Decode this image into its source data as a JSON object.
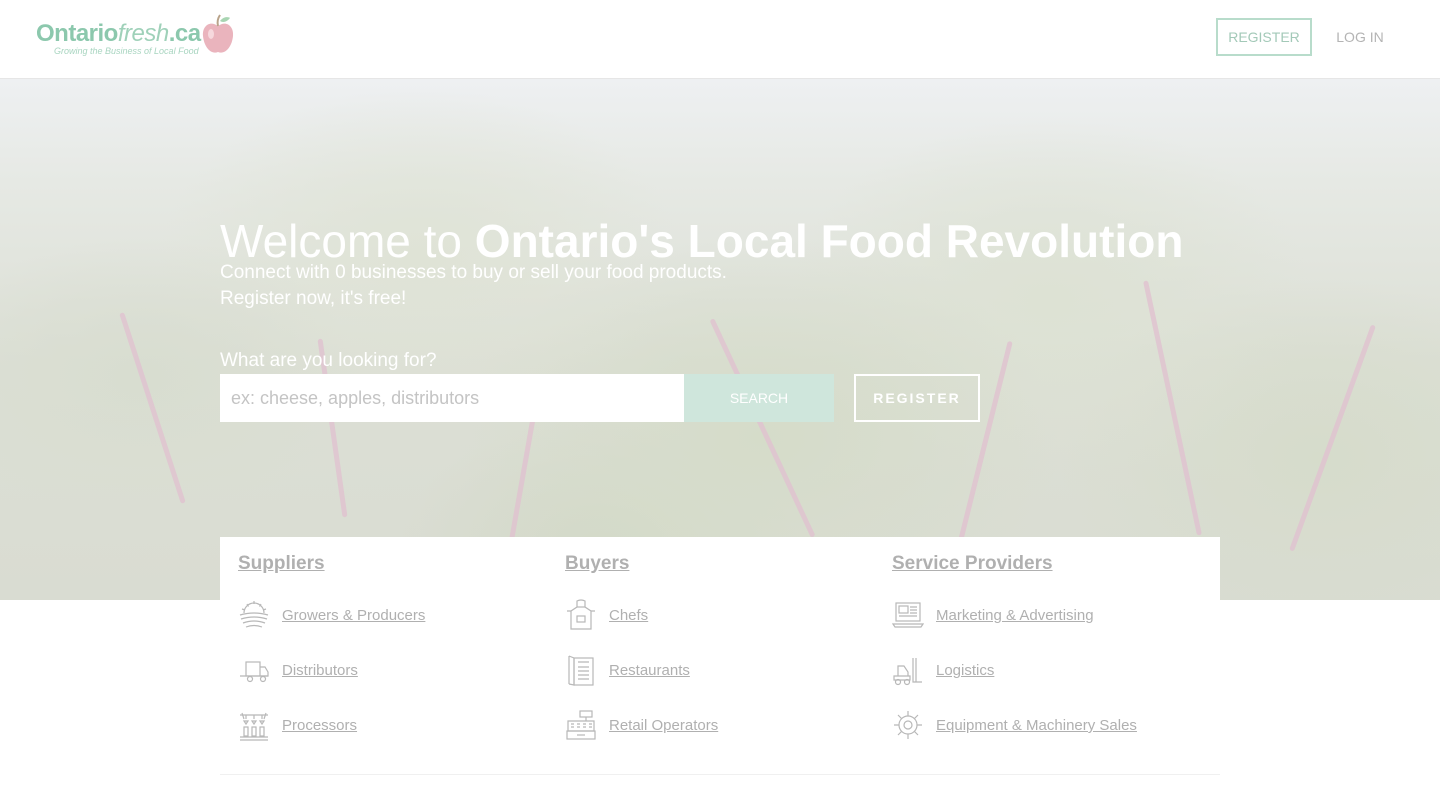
{
  "header": {
    "logo": {
      "word_part1": "Ontario",
      "word_part2": "fresh",
      "word_part3": ".ca",
      "tagline": "Growing the Business of Local Food"
    },
    "register_label": "REGISTER",
    "login_label": "LOG IN"
  },
  "hero": {
    "title_light": "Welcome to ",
    "title_bold": "Ontario's Local Food Revolution",
    "subtitle_line1": "Connect with 0 businesses to buy or sell your food products.",
    "subtitle_line2": "Register now, it's free!",
    "search_prompt": "What are you looking for?",
    "search_placeholder": "ex: cheese, apples, distributors",
    "search_value": "",
    "search_button": "SEARCH",
    "register_button": "REGISTER"
  },
  "categories": [
    {
      "title": "Suppliers",
      "items": [
        {
          "label": "Growers & Producers",
          "icon": "field-sun-icon"
        },
        {
          "label": "Distributors",
          "icon": "truck-icon"
        },
        {
          "label": "Processors",
          "icon": "processing-line-icon"
        }
      ]
    },
    {
      "title": "Buyers",
      "items": [
        {
          "label": "Chefs",
          "icon": "apron-icon"
        },
        {
          "label": "Restaurants",
          "icon": "menu-icon"
        },
        {
          "label": "Retail Operators",
          "icon": "cash-register-icon"
        }
      ]
    },
    {
      "title": "Service Providers",
      "items": [
        {
          "label": "Marketing & Advertising",
          "icon": "laptop-ad-icon"
        },
        {
          "label": "Logistics",
          "icon": "forklift-icon"
        },
        {
          "label": "Equipment & Machinery Sales",
          "icon": "gear-icon"
        }
      ]
    }
  ],
  "colors": {
    "brand_green": "#8cc8ad",
    "search_button_bg": "#cfe6dc",
    "link_gray": "#b0b0b0"
  }
}
